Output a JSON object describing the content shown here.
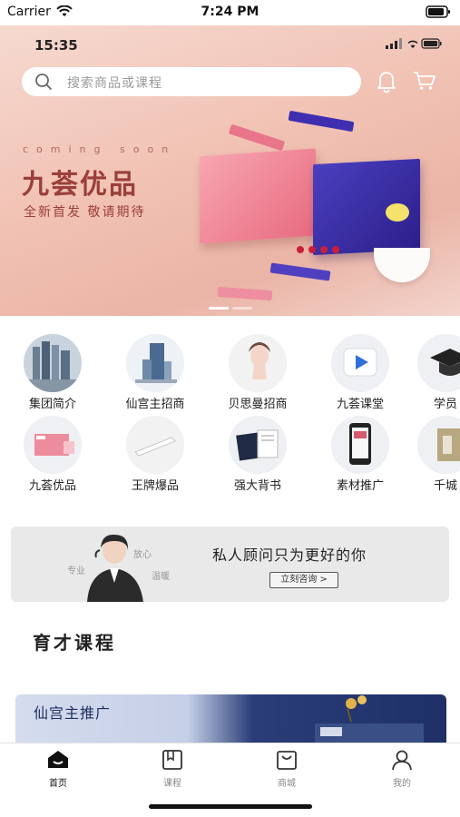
{
  "status_bar": {
    "carrier": "Carrier",
    "time": "7:24 PM"
  },
  "banner": {
    "inner_time": "15:35",
    "search_placeholder": "搜索商品或课程",
    "coming_soon": "coming soon",
    "title": "九荟优品",
    "slogan": "全新首发 敬请期待"
  },
  "categories": [
    {
      "label": "集团简介",
      "icon": "building-icon"
    },
    {
      "label": "仙宫主招商",
      "icon": "tower-icon"
    },
    {
      "label": "贝思曼招商",
      "icon": "model-icon"
    },
    {
      "label": "九荟课堂",
      "icon": "play-icon"
    },
    {
      "label": "学员",
      "icon": "graduation-cap-icon"
    },
    {
      "label": "九荟优品",
      "icon": "product-box-icon"
    },
    {
      "label": "王牌爆品",
      "icon": "product-strip-icon"
    },
    {
      "label": "强大背书",
      "icon": "certificate-icon"
    },
    {
      "label": "素材推广",
      "icon": "phone-icon"
    },
    {
      "label": "千城",
      "icon": "storefront-icon"
    }
  ],
  "consult": {
    "title": "私人顾问只为更好的你",
    "button": "立刻咨询 >",
    "words": [
      "专业",
      "放心",
      "温暖"
    ]
  },
  "section": {
    "title": "育才课程"
  },
  "course": {
    "label": "仙宫主推广"
  },
  "tabs": [
    {
      "label": "首页",
      "icon": "home-icon",
      "active": true
    },
    {
      "label": "课程",
      "icon": "book-icon",
      "active": false
    },
    {
      "label": "商城",
      "icon": "shopping-bag-icon",
      "active": false
    },
    {
      "label": "我的",
      "icon": "user-icon",
      "active": false
    }
  ],
  "colors": {
    "accent_dark": "#9b3f3a",
    "banner_pink": "#f1c2b4",
    "tab_active": "#111111"
  }
}
